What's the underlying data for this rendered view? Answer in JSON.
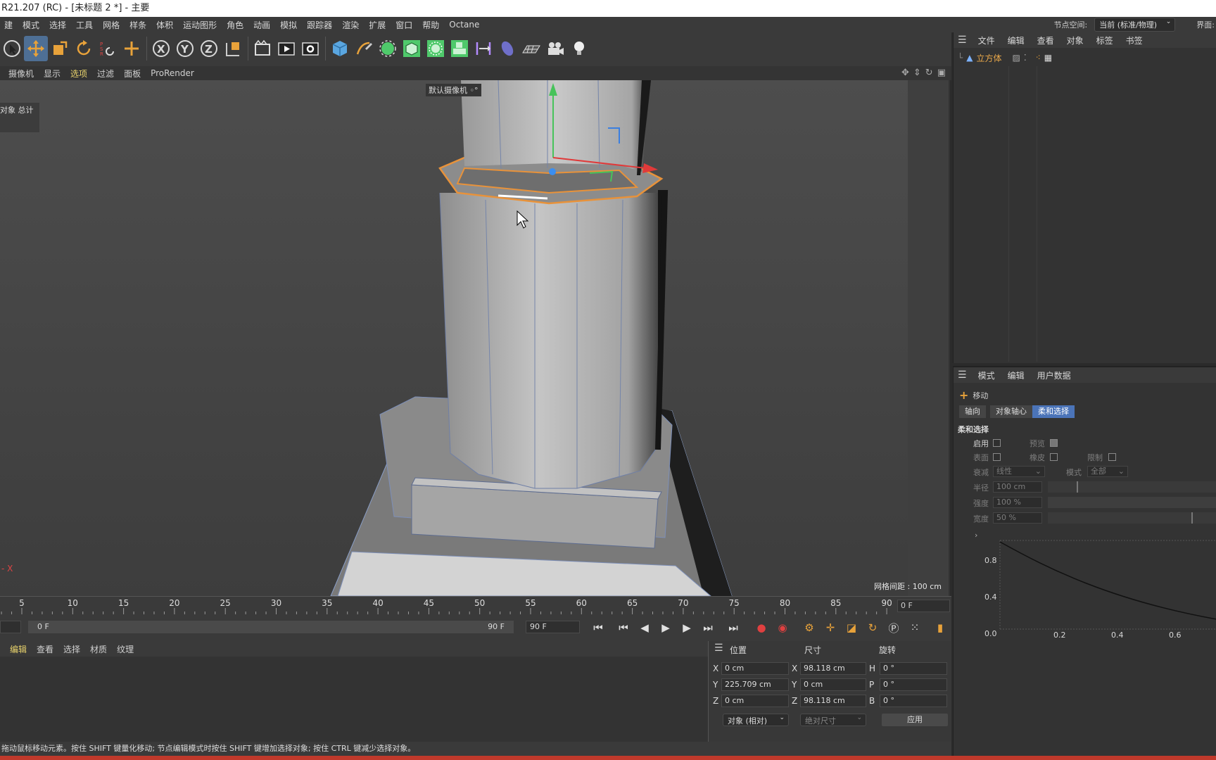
{
  "window": {
    "title": "R21.207 (RC) - [未标题 2 *] - 主要"
  },
  "menubar": {
    "items": [
      "建",
      "模式",
      "选择",
      "工具",
      "网格",
      "样条",
      "体积",
      "运动图形",
      "角色",
      "动画",
      "模拟",
      "跟踪器",
      "渲染",
      "扩展",
      "窗口",
      "帮助",
      "Octane"
    ],
    "node_space_label": "节点空间:",
    "node_space_value": "当前 (标准/物理)",
    "layout_label": "界面:"
  },
  "viewport_menu": {
    "items": [
      "摄像机",
      "显示",
      "选项",
      "过滤",
      "面板",
      "ProRender"
    ],
    "active_index": 2
  },
  "viewport": {
    "camera_label": "默认摄像机",
    "hud_text": "对象 总计",
    "grid_spacing": "网格间距 : 100 cm",
    "axis_label": "X"
  },
  "timeline": {
    "ticks": [
      "5",
      "10",
      "15",
      "20",
      "25",
      "30",
      "35",
      "40",
      "45",
      "50",
      "55",
      "60",
      "65",
      "70",
      "75",
      "80",
      "85",
      "90"
    ],
    "current_frame": "0 F"
  },
  "transport": {
    "start": "0 F",
    "end": "90 F",
    "max": "90 F"
  },
  "material_menu": {
    "items": [
      "编辑",
      "查看",
      "选择",
      "材质",
      "纹理"
    ],
    "active_index": 0
  },
  "coords": {
    "headers": [
      "位置",
      "尺寸",
      "旋转"
    ],
    "rows": [
      {
        "axis": "X",
        "pos": "0 cm",
        "size_axis": "X",
        "size": "98.118 cm",
        "rot_axis": "H",
        "rot": "0 °"
      },
      {
        "axis": "Y",
        "pos": "225.709 cm",
        "size_axis": "Y",
        "size": "0 cm",
        "rot_axis": "P",
        "rot": "0 °"
      },
      {
        "axis": "Z",
        "pos": "0 cm",
        "size_axis": "Z",
        "size": "98.118 cm",
        "rot_axis": "B",
        "rot": "0 °"
      }
    ],
    "mode_select": "对象 (相对)",
    "size_select": "绝对尺寸",
    "apply_label": "应用"
  },
  "status_text": "拖动鼠标移动元素。按住 SHIFT 键量化移动; 节点编辑模式时按住 SHIFT 键增加选择对象; 按住 CTRL 键减少选择对象。",
  "object_manager": {
    "menu": [
      "文件",
      "编辑",
      "查看",
      "对象",
      "标签",
      "书签"
    ],
    "object_name": "立方体"
  },
  "attributes": {
    "menu": [
      "模式",
      "编辑",
      "用户数据"
    ],
    "tool_name": "移动",
    "tabs": [
      "轴向",
      "对象轴心",
      "柔和选择"
    ],
    "active_tab": 2,
    "section_title": "柔和选择",
    "enable_label": "启用",
    "preview_label": "预览",
    "surface_label": "表面",
    "rubber_label": "橡皮",
    "limit_label": "限制",
    "falloff_label": "衰减",
    "falloff_value": "线性",
    "mode_label": "模式",
    "mode_value": "全部",
    "radius_label": "半径",
    "radius_value": "100 cm",
    "strength_label": "强度",
    "strength_value": "100 %",
    "width_label": "宽度",
    "width_value": "50 %",
    "radius_slider": 0.17,
    "width_slider": 0.85,
    "graph_y_labels": [
      "0.8",
      "0.4",
      "0.0"
    ],
    "graph_x_labels": [
      "0.2",
      "0.4",
      "0.6"
    ]
  }
}
